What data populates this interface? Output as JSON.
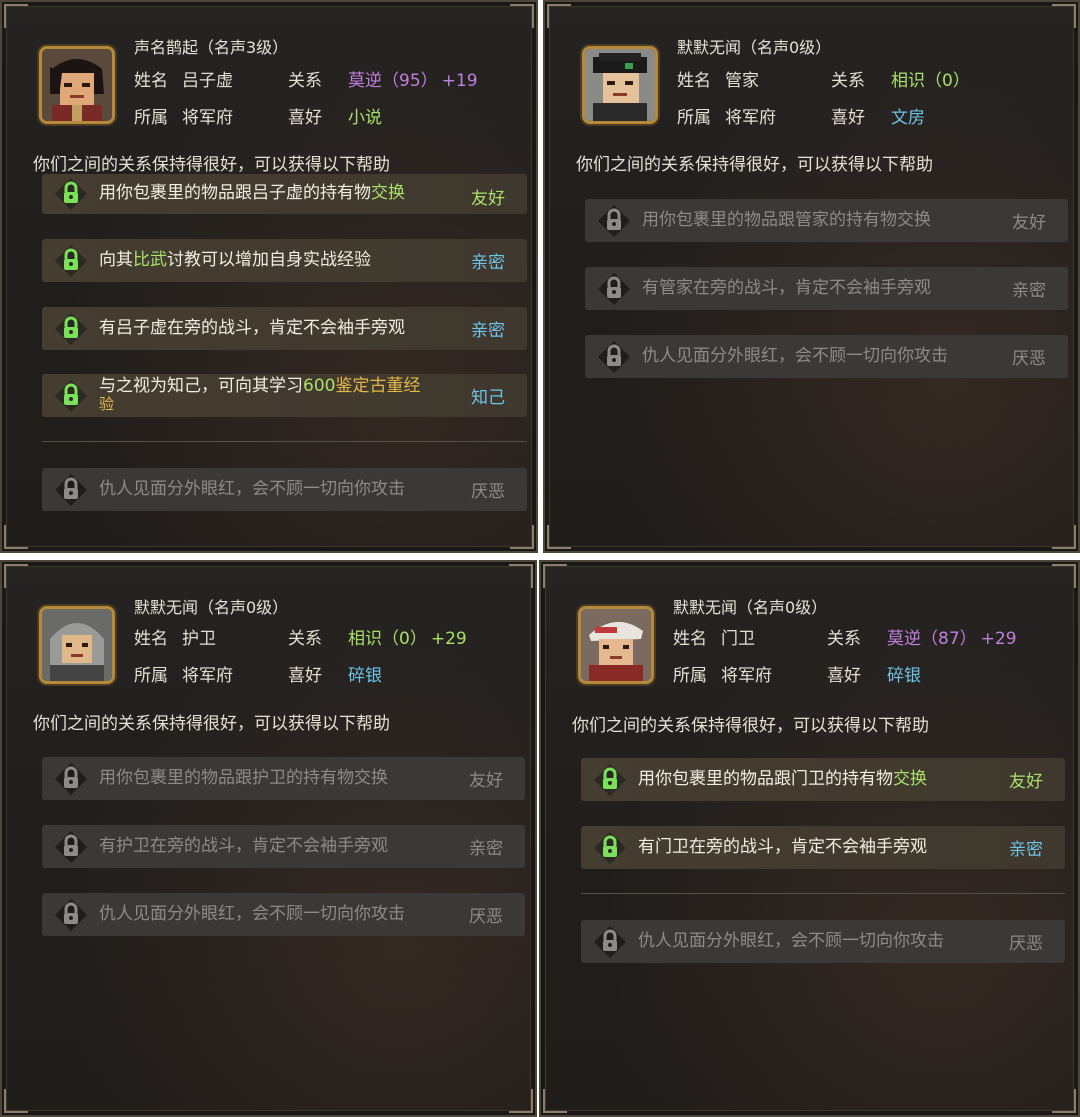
{
  "intro_text": "你们之间的关系保持得很好，可以获得以下帮助",
  "labels": {
    "name": "姓名",
    "relation": "关系",
    "faction": "所属",
    "hobby": "喜好"
  },
  "colors": {
    "friendly_green": "#a8e06a",
    "nemesis_purple": "#c17fe0",
    "item_blue": "#6ec3e8",
    "gold": "#e2b84a",
    "locked_gray": "#8e8b86"
  },
  "panels": [
    {
      "fame": "声名鹊起（名声3级）",
      "name": "吕子虚",
      "relation": "莫逆（95）",
      "relation_bonus": "+19",
      "faction": "将军府",
      "hobby": "小说",
      "rows": [
        {
          "pre": "用你包裹里的物品跟吕子虚的持有物",
          "hl": "交换",
          "post": "",
          "tier": "友好"
        },
        {
          "pre": "向其",
          "hl": "比武",
          "post": "讨教可以增加自身实战经验",
          "tier": "亲密"
        },
        {
          "pre": "有吕子虚在旁的战斗，肯定不会袖手旁观",
          "tier": "亲密"
        },
        {
          "pre": "与之视为知己，可向其学习",
          "hl": "600",
          "hl2": "鉴定古董经",
          "line2": "验",
          "tier": "知己"
        },
        {
          "pre": "仇人见面分外眼红，会不顾一切向你攻击",
          "tier": "厌恶"
        }
      ]
    },
    {
      "fame": "默默无闻（名声0级）",
      "name": "管家",
      "relation": "相识（0）",
      "faction": "将军府",
      "hobby": "文房",
      "rows": [
        {
          "pre": "用你包裹里的物品跟管家的持有物交换",
          "tier": "友好"
        },
        {
          "pre": "有管家在旁的战斗，肯定不会袖手旁观",
          "tier": "亲密"
        },
        {
          "pre": "仇人见面分外眼红，会不顾一切向你攻击",
          "tier": "厌恶"
        }
      ]
    },
    {
      "fame": "默默无闻（名声0级）",
      "name": "护卫",
      "relation": "相识（0）",
      "relation_bonus": "+29",
      "faction": "将军府",
      "hobby": "碎银",
      "rows": [
        {
          "pre": "用你包裹里的物品跟护卫的持有物交换",
          "tier": "友好"
        },
        {
          "pre": "有护卫在旁的战斗，肯定不会袖手旁观",
          "tier": "亲密"
        },
        {
          "pre": "仇人见面分外眼红，会不顾一切向你攻击",
          "tier": "厌恶"
        }
      ]
    },
    {
      "fame": "默默无闻（名声0级）",
      "name": "门卫",
      "relation": "莫逆（87）",
      "relation_bonus": "+29",
      "faction": "将军府",
      "hobby": "碎银",
      "rows": [
        {
          "pre": "用你包裹里的物品跟门卫的持有物",
          "hl": "交换",
          "post": "",
          "tier": "友好"
        },
        {
          "pre": "有门卫在旁的战斗，肯定不会袖手旁观",
          "tier": "亲密"
        },
        {
          "pre": "仇人见面分外眼红，会不顾一切向你攻击",
          "tier": "厌恶"
        }
      ]
    }
  ]
}
